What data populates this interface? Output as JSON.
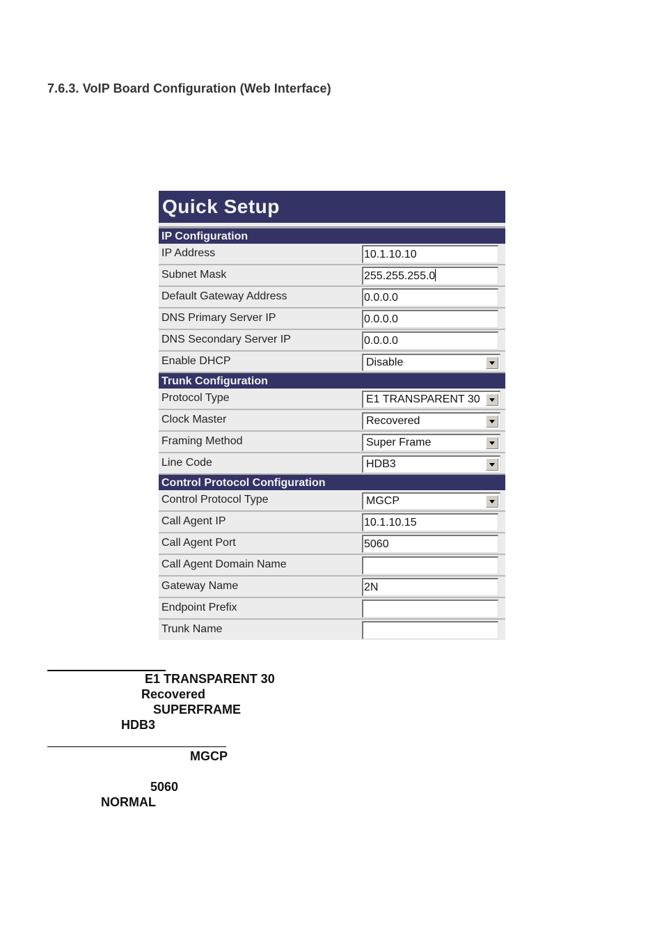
{
  "heading": "7.6.3.  VoIP Board Configuration (Web Interface)",
  "panel": {
    "title": "Quick Setup",
    "sections": [
      {
        "name": "IP Configuration",
        "rows": [
          {
            "label": "IP Address",
            "type": "input",
            "value": "10.1.10.10"
          },
          {
            "label": "Subnet Mask",
            "type": "input",
            "value": "255.255.255.0",
            "focused": true
          },
          {
            "label": "Default Gateway Address",
            "type": "input",
            "value": "0.0.0.0"
          },
          {
            "label": "DNS Primary Server IP",
            "type": "input",
            "value": "0.0.0.0"
          },
          {
            "label": "DNS Secondary Server IP",
            "type": "input",
            "value": "0.0.0.0"
          },
          {
            "label": "Enable DHCP",
            "type": "select",
            "value": "Disable"
          }
        ]
      },
      {
        "name": "Trunk Configuration",
        "rows": [
          {
            "label": "Protocol Type",
            "type": "select",
            "value": "E1 TRANSPARENT 30"
          },
          {
            "label": "Clock Master",
            "type": "select",
            "value": "Recovered"
          },
          {
            "label": "Framing Method",
            "type": "select",
            "value": "Super Frame"
          },
          {
            "label": "Line Code",
            "type": "select",
            "value": "HDB3"
          }
        ]
      },
      {
        "name": "Control Protocol Configuration",
        "rows": [
          {
            "label": "Control Protocol Type",
            "type": "select",
            "value": "MGCP"
          },
          {
            "label": "Call Agent IP",
            "type": "input",
            "value": "10.1.10.15"
          },
          {
            "label": "Call Agent Port",
            "type": "input",
            "value": "5060"
          },
          {
            "label": "Call Agent Domain Name",
            "type": "input",
            "value": ""
          },
          {
            "label": "Gateway Name",
            "type": "input",
            "value": "2N"
          },
          {
            "label": "Endpoint Prefix",
            "type": "input",
            "value": ""
          },
          {
            "label": "Trunk Name",
            "type": "input",
            "value": ""
          }
        ]
      }
    ]
  },
  "notes": {
    "trunk": [
      "E1 TRANSPARENT 30",
      "Recovered",
      "SUPERFRAME",
      "HDB3"
    ],
    "control": [
      "MGCP",
      "5060",
      "NORMAL"
    ]
  },
  "colors": {
    "panel_header": "#333366",
    "row_background": "#ececec"
  }
}
